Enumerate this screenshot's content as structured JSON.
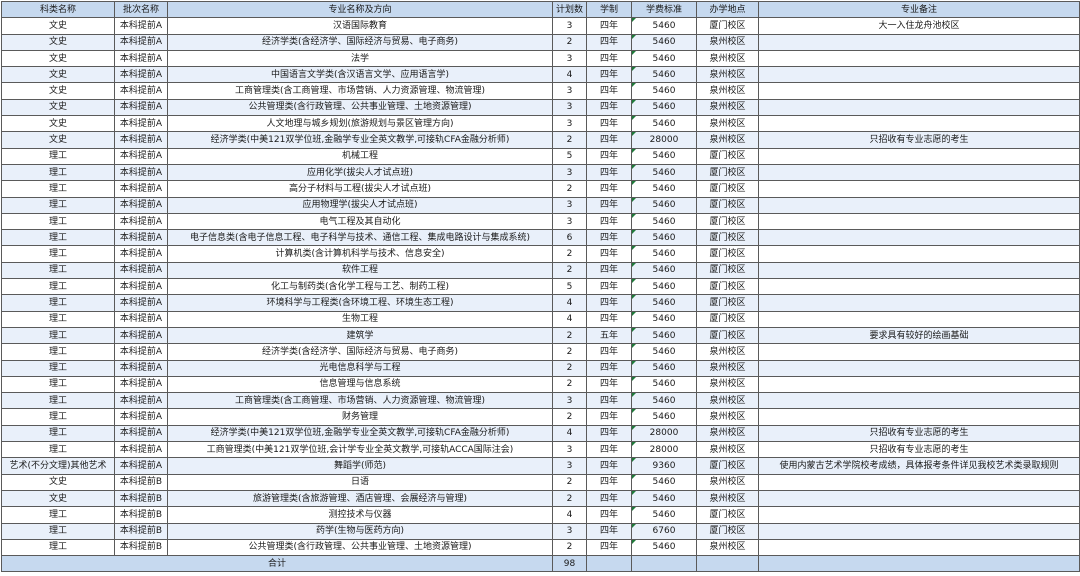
{
  "headers": [
    "科类名称",
    "批次名称",
    "专业名称及方向",
    "计划数",
    "学制",
    "学费标准",
    "办学地点",
    "专业备注"
  ],
  "rows": [
    [
      "文史",
      "本科提前A",
      "汉语国际教育",
      "3",
      "四年",
      "5460",
      "厦门校区",
      "大一入住龙舟池校区"
    ],
    [
      "文史",
      "本科提前A",
      "经济学类(含经济学、国际经济与贸易、电子商务)",
      "2",
      "四年",
      "5460",
      "泉州校区",
      ""
    ],
    [
      "文史",
      "本科提前A",
      "法学",
      "3",
      "四年",
      "5460",
      "泉州校区",
      ""
    ],
    [
      "文史",
      "本科提前A",
      "中国语言文学类(含汉语言文学、应用语言学)",
      "4",
      "四年",
      "5460",
      "泉州校区",
      ""
    ],
    [
      "文史",
      "本科提前A",
      "工商管理类(含工商管理、市场营销、人力资源管理、物流管理)",
      "3",
      "四年",
      "5460",
      "泉州校区",
      ""
    ],
    [
      "文史",
      "本科提前A",
      "公共管理类(含行政管理、公共事业管理、土地资源管理)",
      "3",
      "四年",
      "5460",
      "泉州校区",
      ""
    ],
    [
      "文史",
      "本科提前A",
      "人文地理与城乡规划(旅游规划与景区管理方向)",
      "3",
      "四年",
      "5460",
      "泉州校区",
      ""
    ],
    [
      "文史",
      "本科提前A",
      "经济学类(中美121双学位班,金融学专业全英文教学,可接轨CFA金融分析师)",
      "2",
      "四年",
      "28000",
      "泉州校区",
      "只招收有专业志愿的考生"
    ],
    [
      "理工",
      "本科提前A",
      "机械工程",
      "5",
      "四年",
      "5460",
      "厦门校区",
      ""
    ],
    [
      "理工",
      "本科提前A",
      "应用化学(拔尖人才试点班)",
      "3",
      "四年",
      "5460",
      "厦门校区",
      ""
    ],
    [
      "理工",
      "本科提前A",
      "高分子材料与工程(拔尖人才试点班)",
      "2",
      "四年",
      "5460",
      "厦门校区",
      ""
    ],
    [
      "理工",
      "本科提前A",
      "应用物理学(拔尖人才试点班)",
      "3",
      "四年",
      "5460",
      "厦门校区",
      ""
    ],
    [
      "理工",
      "本科提前A",
      "电气工程及其自动化",
      "3",
      "四年",
      "5460",
      "厦门校区",
      ""
    ],
    [
      "理工",
      "本科提前A",
      "电子信息类(含电子信息工程、电子科学与技术、通信工程、集成电路设计与集成系统)",
      "6",
      "四年",
      "5460",
      "厦门校区",
      ""
    ],
    [
      "理工",
      "本科提前A",
      "计算机类(含计算机科学与技术、信息安全)",
      "2",
      "四年",
      "5460",
      "厦门校区",
      ""
    ],
    [
      "理工",
      "本科提前A",
      "软件工程",
      "2",
      "四年",
      "5460",
      "厦门校区",
      ""
    ],
    [
      "理工",
      "本科提前A",
      "化工与制药类(含化学工程与工艺、制药工程)",
      "5",
      "四年",
      "5460",
      "厦门校区",
      ""
    ],
    [
      "理工",
      "本科提前A",
      "环境科学与工程类(含环境工程、环境生态工程)",
      "4",
      "四年",
      "5460",
      "厦门校区",
      ""
    ],
    [
      "理工",
      "本科提前A",
      "生物工程",
      "4",
      "四年",
      "5460",
      "厦门校区",
      ""
    ],
    [
      "理工",
      "本科提前A",
      "建筑学",
      "2",
      "五年",
      "5460",
      "厦门校区",
      "要求具有较好的绘画基础"
    ],
    [
      "理工",
      "本科提前A",
      "经济学类(含经济学、国际经济与贸易、电子商务)",
      "2",
      "四年",
      "5460",
      "泉州校区",
      ""
    ],
    [
      "理工",
      "本科提前A",
      "光电信息科学与工程",
      "2",
      "四年",
      "5460",
      "泉州校区",
      ""
    ],
    [
      "理工",
      "本科提前A",
      "信息管理与信息系统",
      "2",
      "四年",
      "5460",
      "泉州校区",
      ""
    ],
    [
      "理工",
      "本科提前A",
      "工商管理类(含工商管理、市场营销、人力资源管理、物流管理)",
      "3",
      "四年",
      "5460",
      "泉州校区",
      ""
    ],
    [
      "理工",
      "本科提前A",
      "财务管理",
      "2",
      "四年",
      "5460",
      "泉州校区",
      ""
    ],
    [
      "理工",
      "本科提前A",
      "经济学类(中美121双学位班,金融学专业全英文教学,可接轨CFA金融分析师)",
      "4",
      "四年",
      "28000",
      "泉州校区",
      "只招收有专业志愿的考生"
    ],
    [
      "理工",
      "本科提前A",
      "工商管理类(中美121双学位班,会计学专业全英文教学,可接轨ACCA国际注会)",
      "3",
      "四年",
      "28000",
      "泉州校区",
      "只招收有专业志愿的考生"
    ],
    [
      "艺术(不分文理)其他艺术",
      "本科提前A",
      "舞蹈学(师范)",
      "3",
      "四年",
      "9360",
      "厦门校区",
      "使用内蒙古艺术学院校考成绩，具体报考条件详见我校艺术类录取规则"
    ],
    [
      "文史",
      "本科提前B",
      "日语",
      "2",
      "四年",
      "5460",
      "泉州校区",
      ""
    ],
    [
      "文史",
      "本科提前B",
      "旅游管理类(含旅游管理、酒店管理、会展经济与管理)",
      "2",
      "四年",
      "5460",
      "泉州校区",
      ""
    ],
    [
      "理工",
      "本科提前B",
      "测控技术与仪器",
      "4",
      "四年",
      "5460",
      "厦门校区",
      ""
    ],
    [
      "理工",
      "本科提前B",
      "药学(生物与医药方向)",
      "3",
      "四年",
      "6760",
      "厦门校区",
      ""
    ],
    [
      "理工",
      "本科提前B",
      "公共管理类(含行政管理、公共事业管理、土地资源管理)",
      "2",
      "四年",
      "5460",
      "泉州校区",
      ""
    ]
  ],
  "footer": {
    "label": "合计",
    "total": "98"
  }
}
